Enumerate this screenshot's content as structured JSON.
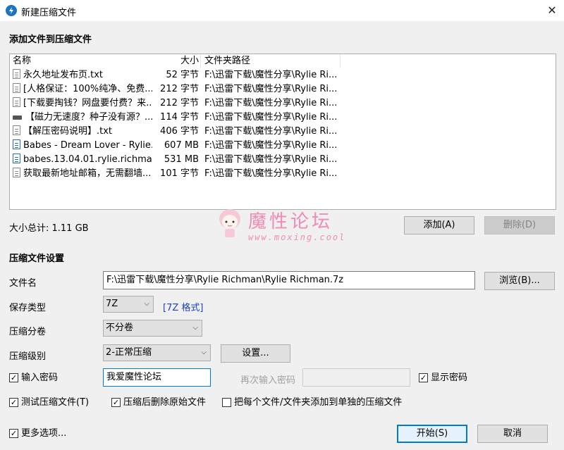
{
  "window": {
    "title": "新建压缩文件",
    "close_glyph": "✕"
  },
  "add_section": {
    "title": "添加文件到压缩文件"
  },
  "file_list": {
    "columns": {
      "name": "名称",
      "size": "大小",
      "path": "文件夹路径"
    },
    "rows": [
      {
        "icon": "text-file-icon",
        "name": "永久地址发布页.txt",
        "size": "52 字节",
        "path": "F:\\迅雷下载\\魔性分享\\Rylie Ri..."
      },
      {
        "icon": "text-file-icon",
        "name": "[人格保证：100%纯净、免费...",
        "size": "212 字节",
        "path": "F:\\迅雷下载\\魔性分享\\Rylie Ri..."
      },
      {
        "icon": "text-file-icon",
        "name": "[下载要掏钱？网盘要付费？来...",
        "size": "212 字节",
        "path": "F:\\迅雷下载\\魔性分享\\Rylie Ri..."
      },
      {
        "icon": "executable-file-icon",
        "name": "【磁力无速度？种子没有源？...",
        "size": "114 字节",
        "path": "F:\\迅雷下载\\魔性分享\\Rylie Ri..."
      },
      {
        "icon": "text-file-icon",
        "name": "【解压密码说明】.txt",
        "size": "406 字节",
        "path": "F:\\迅雷下载\\魔性分享\\Rylie Ri..."
      },
      {
        "icon": "video-file-icon",
        "name": "Babes - Dream Lover - Rylie...",
        "size": "607 MB",
        "path": "F:\\迅雷下载\\魔性分享\\Rylie Ri..."
      },
      {
        "icon": "video-file-icon",
        "name": "babes.13.04.01.rylie.richma...",
        "size": "531 MB",
        "path": "F:\\迅雷下载\\魔性分享\\Rylie Ri..."
      },
      {
        "icon": "text-file-icon",
        "name": "获取最新地址邮箱，无需翻墙...",
        "size": "101 字节",
        "path": "F:\\迅雷下载\\魔性分享\\Rylie Ri..."
      }
    ]
  },
  "total_size": "大小总计: 1.11 GB",
  "buttons": {
    "add": "添加(A)",
    "remove": "删除(D)",
    "browse": "浏览(B)...",
    "settings": "设置...",
    "ok": "开始(S)",
    "cancel": "取消"
  },
  "watermark": {
    "title": "魔性论坛",
    "url": "www.moxing.cool"
  },
  "settings_section": {
    "title": "压缩文件设置",
    "filename_label": "文件名",
    "filename_value": "F:\\迅雷下载\\魔性分享\\Rylie Richman\\Rylie Richman.7z",
    "format_label": "保存类型",
    "format_value": "7Z",
    "format_note": "[7Z 格式]",
    "split_label": "压缩分卷",
    "split_value": "不分卷",
    "level_label": "压缩级别",
    "level_value": "2-正常压缩",
    "password_check": "输入密码",
    "password_value": "我爱魔性论坛",
    "reenter_label": "再次输入密码",
    "show_password": "显示密码",
    "test_archive": "测试压缩文件(T)",
    "delete_after": "压缩后删除原始文件",
    "separate_archives": "把每个文件/文件夹添加到单独的压缩文件",
    "more_options": "更多选项..."
  },
  "checked": {
    "password": true,
    "show_password": true,
    "test": true,
    "delete_after": true,
    "separate": false,
    "more": true
  },
  "check_glyph": "✓",
  "dropdown_glyph": "⌵"
}
